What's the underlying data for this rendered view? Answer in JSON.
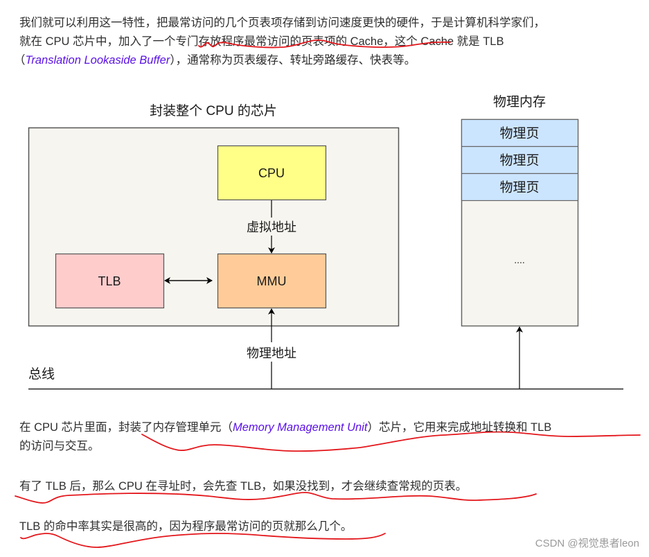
{
  "intro": {
    "line1": "我们就可以利用这一特性，把最常访问的几个页表项存储到访问速度更快的硬件，于是计算机科学家们，",
    "line2": "就在 CPU 芯片中，加入了一个专门存放程序最常访问的页表项的 Cache，这个 Cache 就是 TLB",
    "line3_prefix": "（",
    "line3_term": "Translation Lookaside Buffer",
    "line3_suffix": "），通常称为页表缓存、转址旁路缓存、快表等。"
  },
  "diagram": {
    "chip_title": "封装整个 CPU 的芯片",
    "cpu_label": "CPU",
    "mmu_label": "MMU",
    "tlb_label": "TLB",
    "virtual_address_label": "虚拟地址",
    "physical_address_label": "物理地址",
    "bus_label": "总线",
    "memory_title": "物理内存",
    "memory_pages": [
      "物理页",
      "物理页",
      "物理页"
    ],
    "memory_ellipsis": "....",
    "colors": {
      "chip_fill": "#f7f5ef",
      "cpu_fill": "#ffff88",
      "mmu_fill": "#ffcc99",
      "tlb_fill": "#ffcccc",
      "page_fill": "#cce5ff"
    }
  },
  "para2": {
    "prefix": "在 CPU 芯片里面，封装了内存管理单元（",
    "term": "Memory Management Unit",
    "suffix": "）芯片，它用来完成地址转换和 TLB",
    "line2": "的访问与交互。"
  },
  "para3": "有了 TLB 后，那么 CPU 在寻址时，会先查 TLB，如果没找到，才会继续查常规的页表。",
  "para4": "TLB 的命中率其实是很高的，因为程序最常访问的页就那么几个。",
  "watermark": "CSDN @视觉患者leon"
}
